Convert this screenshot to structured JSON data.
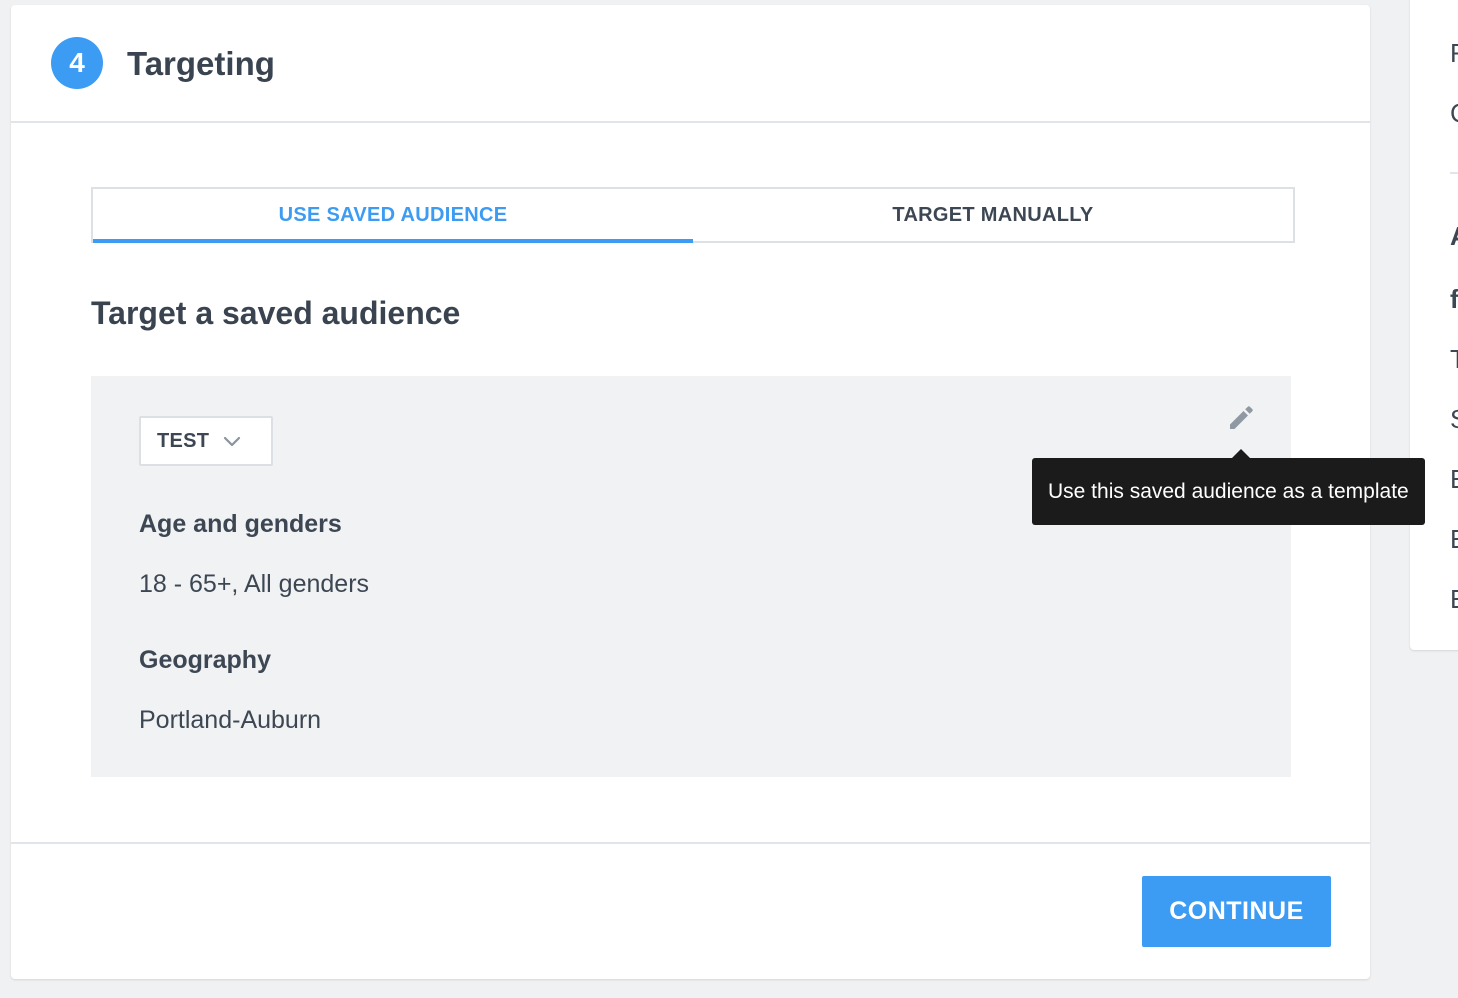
{
  "step": {
    "number": "4",
    "title": "Targeting"
  },
  "tabs": [
    {
      "label": "USE SAVED AUDIENCE",
      "active": true
    },
    {
      "label": "TARGET MANUALLY",
      "active": false
    }
  ],
  "section_title": "Target a saved audience",
  "audience": {
    "selected": "TEST",
    "fields": [
      {
        "label": "Age and genders",
        "value": "18 - 65+, All genders"
      },
      {
        "label": "Geography",
        "value": "Portland-Auburn"
      }
    ],
    "edit_tooltip": "Use this saved audience as a template"
  },
  "footer": {
    "continue_label": "CONTINUE"
  },
  "side_panel": {
    "glyphs": [
      "F",
      "C",
      "A",
      "f",
      "T",
      "S",
      "E",
      "E",
      "E"
    ]
  },
  "colors": {
    "accent": "#3c9bf2",
    "text": "#3d4753",
    "panel_bg": "#f1f2f4",
    "tooltip_bg": "#1b1b1b"
  },
  "icons": {
    "edit": "pencil-icon",
    "dropdown": "chevron-down-icon"
  }
}
